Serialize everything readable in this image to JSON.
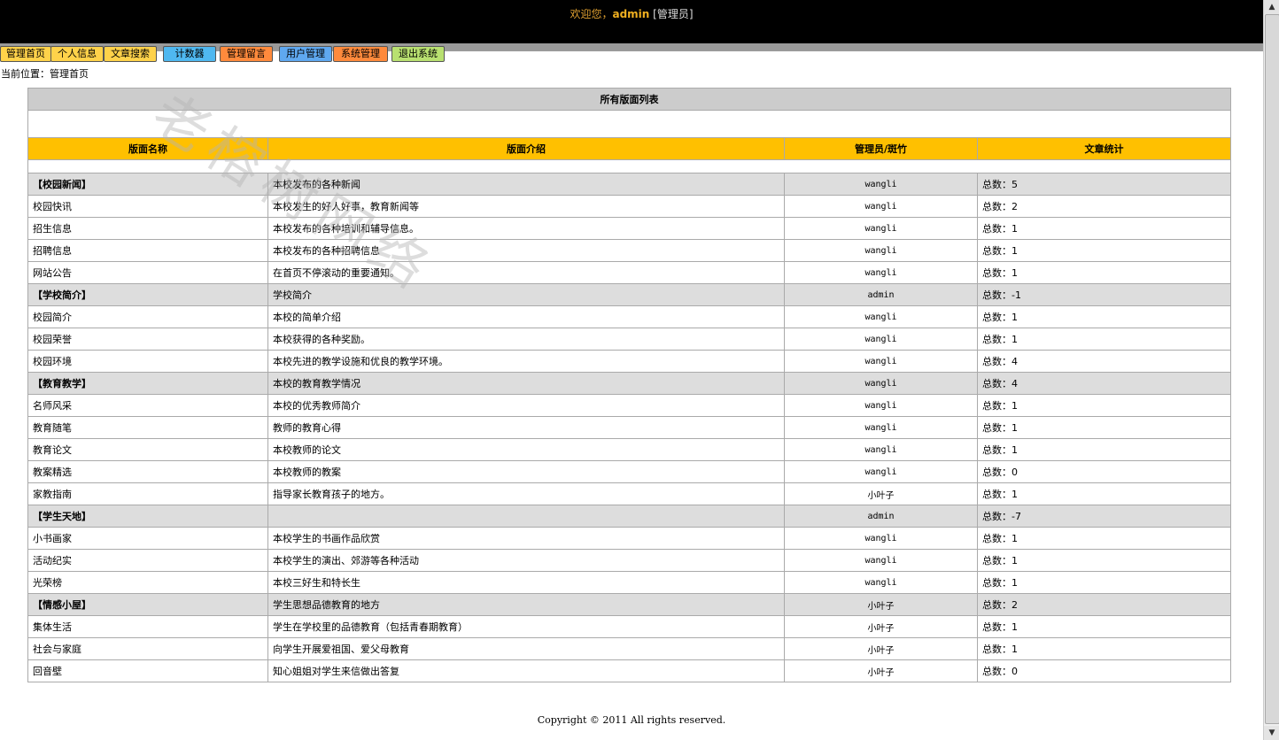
{
  "header": {
    "welcome": "欢迎您，",
    "user": "admin",
    "role": "[管理员]"
  },
  "nav": [
    {
      "label": "管理首页",
      "color": "#ffd24a"
    },
    {
      "label": "个人信息",
      "color": "#ffd24a"
    },
    {
      "label": "文章搜索",
      "color": "#ffd24a"
    },
    {
      "label": "计数器",
      "color": "#4fb8f0"
    },
    {
      "label": "管理留言",
      "color": "#ff8a3c"
    },
    {
      "label": "用户管理",
      "color": "#5fa8f0"
    },
    {
      "label": "系统管理",
      "color": "#ff8a3c"
    },
    {
      "label": "退出系统",
      "color": "#b8e070"
    }
  ],
  "breadcrumb": "当前位置：管理首页",
  "watermark": "老榕树网络",
  "table": {
    "title": "所有版面列表",
    "columns": [
      "版面名称",
      "版面介绍",
      "管理员/斑竹",
      "文章统计"
    ],
    "rows": [
      {
        "name": "【校园新闻】",
        "desc": "本校发布的各种新闻",
        "admin": "wangli",
        "count": "总数：5",
        "category": true
      },
      {
        "name": "校园快讯",
        "desc": "本校发生的好人好事，教育新闻等",
        "admin": "wangli",
        "count": "总数：2",
        "category": false
      },
      {
        "name": "招生信息",
        "desc": "本校发布的各种培训和辅导信息。",
        "admin": "wangli",
        "count": "总数：1",
        "category": false
      },
      {
        "name": "招聘信息",
        "desc": "本校发布的各种招聘信息",
        "admin": "wangli",
        "count": "总数：1",
        "category": false
      },
      {
        "name": "网站公告",
        "desc": "在首页不停滚动的重要通知。",
        "admin": "wangli",
        "count": "总数：1",
        "category": false
      },
      {
        "name": "【学校简介】",
        "desc": "学校简介",
        "admin": "admin",
        "count": "总数：-1",
        "category": true
      },
      {
        "name": "校园简介",
        "desc": "本校的简单介绍",
        "admin": "wangli",
        "count": "总数：1",
        "category": false
      },
      {
        "name": "校园荣誉",
        "desc": "本校获得的各种奖励。",
        "admin": "wangli",
        "count": "总数：1",
        "category": false
      },
      {
        "name": "校园环境",
        "desc": "本校先进的教学设施和优良的教学环境。",
        "admin": "wangli",
        "count": "总数：4",
        "category": false
      },
      {
        "name": "【教育教学】",
        "desc": "本校的教育教学情况",
        "admin": "wangli",
        "count": "总数：4",
        "category": true
      },
      {
        "name": "名师风采",
        "desc": "本校的优秀教师简介",
        "admin": "wangli",
        "count": "总数：1",
        "category": false
      },
      {
        "name": "教育随笔",
        "desc": "教师的教育心得",
        "admin": "wangli",
        "count": "总数：1",
        "category": false
      },
      {
        "name": "教育论文",
        "desc": "本校教师的论文",
        "admin": "wangli",
        "count": "总数：1",
        "category": false
      },
      {
        "name": "教案精选",
        "desc": "本校教师的教案",
        "admin": "wangli",
        "count": "总数：0",
        "category": false
      },
      {
        "name": "家教指南",
        "desc": "指导家长教育孩子的地方。",
        "admin": "小叶子",
        "count": "总数：1",
        "category": false
      },
      {
        "name": "【学生天地】",
        "desc": "",
        "admin": "admin",
        "count": "总数：-7",
        "category": true
      },
      {
        "name": "小书画家",
        "desc": "本校学生的书画作品欣赏",
        "admin": "wangli",
        "count": "总数：1",
        "category": false
      },
      {
        "name": "活动纪实",
        "desc": "本校学生的演出、郊游等各种活动",
        "admin": "wangli",
        "count": "总数：1",
        "category": false
      },
      {
        "name": "光荣榜",
        "desc": "本校三好生和特长生",
        "admin": "wangli",
        "count": "总数：1",
        "category": false
      },
      {
        "name": "【情感小屋】",
        "desc": "学生思想品德教育的地方",
        "admin": "小叶子",
        "count": "总数：2",
        "category": true
      },
      {
        "name": "集体生活",
        "desc": "学生在学校里的品德教育（包括青春期教育）",
        "admin": "小叶子",
        "count": "总数：1",
        "category": false
      },
      {
        "name": "社会与家庭",
        "desc": "向学生开展爱祖国、爱父母教育",
        "admin": "小叶子",
        "count": "总数：1",
        "category": false
      },
      {
        "name": "回音壁",
        "desc": "知心姐姐对学生来信做出答复",
        "admin": "小叶子",
        "count": "总数：0",
        "category": false
      }
    ]
  },
  "footer": "Copyright © 2011 All rights reserved."
}
